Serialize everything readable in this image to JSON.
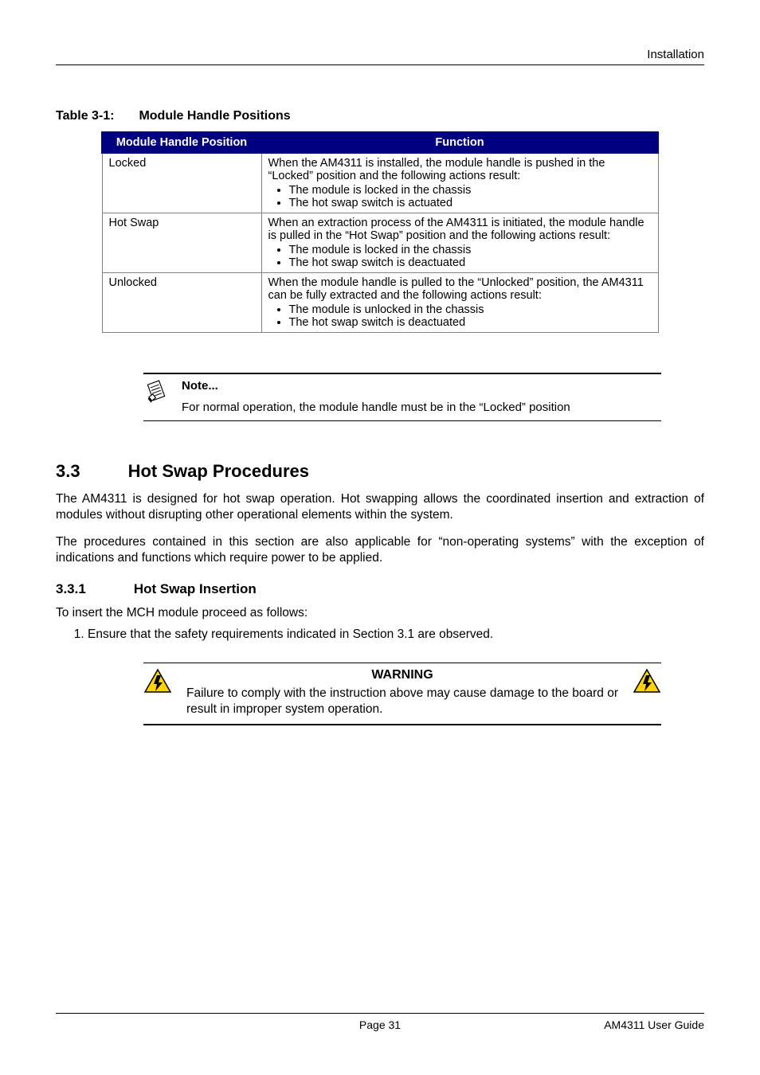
{
  "page_header": "Installation",
  "table_caption_label": "Table 3-1:",
  "table_caption_title": "Module Handle Positions",
  "table": {
    "headers": [
      "Module Handle Position",
      "Function"
    ],
    "rows": [
      {
        "position": "Locked",
        "lead": "When the AM4311 is installed, the module handle is pushed in the “Locked” position and the following actions result:",
        "items": [
          "The module is locked in the chassis",
          "The hot swap switch is actuated"
        ]
      },
      {
        "position": "Hot Swap",
        "lead": "When an extraction process of the AM4311 is initiated, the module handle is pulled in the “Hot Swap” position and the following actions result:",
        "items": [
          "The module is locked in the chassis",
          "The hot swap switch is deactuated"
        ]
      },
      {
        "position": "Unlocked",
        "lead": "When the module handle is pulled to the “Unlocked” position, the AM4311 can be fully extracted and the following actions result:",
        "items": [
          "The module is unlocked in the chassis",
          "The hot swap switch is deactuated"
        ]
      }
    ]
  },
  "note": {
    "heading": "Note...",
    "body": "For normal operation, the module handle must be in the “Locked” position"
  },
  "sections": {
    "s33_num": "3.3",
    "s33_title": "Hot Swap Procedures",
    "s33_p1": "The AM4311 is designed for hot swap operation. Hot swapping allows the coordinated insertion and extraction of modules without disrupting other operational elements within the system.",
    "s33_p2": "The procedures contained in this section are also applicable for “non-operating systems” with the exception of indications and functions which require power to be applied.",
    "s331_num": "3.3.1",
    "s331_title": "Hot Swap Insertion",
    "s331_lead": "To insert the MCH module proceed as follows:",
    "s331_item1": "Ensure that the safety requirements indicated in Section 3.1 are observed."
  },
  "warning": {
    "title": "WARNING",
    "body": "Failure to comply with the instruction above may cause damage to the board or result in improper system operation."
  },
  "footer": {
    "page": "Page 31",
    "doc": "AM4311 User Guide"
  }
}
